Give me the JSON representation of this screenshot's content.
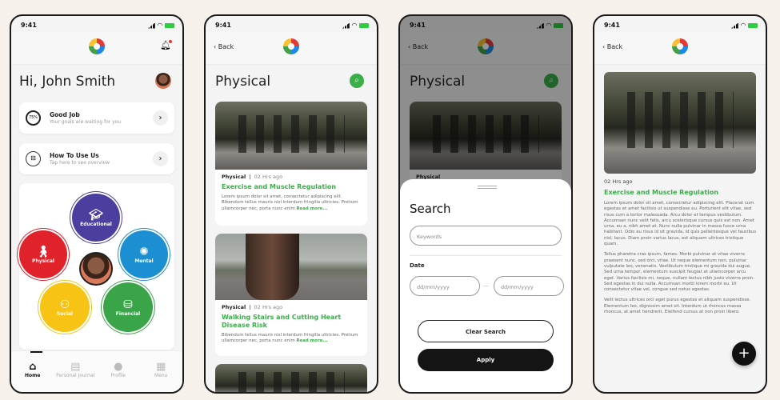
{
  "status": {
    "time": "9:41"
  },
  "home": {
    "greeting": "Hi, John Smith",
    "cards": [
      {
        "badge": "75%",
        "title": "Good Job",
        "subtitle": "Your goals are waiting for you"
      },
      {
        "title": "How To Use Us",
        "subtitle": "Tap here to see overview"
      }
    ],
    "categories": [
      {
        "label": "Educational",
        "color": "#4a3f9f",
        "icon": "graduate-icon"
      },
      {
        "label": "Physical",
        "color": "#e0222a",
        "icon": "walking-icon"
      },
      {
        "label": "Mental",
        "color": "#1b8fd2",
        "icon": "brain-icon"
      },
      {
        "label": "Social",
        "color": "#f7c416",
        "icon": "people-icon"
      },
      {
        "label": "Financial",
        "color": "#3aa449",
        "icon": "coins-icon"
      }
    ],
    "nav": [
      {
        "label": "Home",
        "icon": "home-icon"
      },
      {
        "label": "Personal Journal",
        "icon": "journal-icon"
      },
      {
        "label": "Profile",
        "icon": "profile-icon"
      },
      {
        "label": "Menu",
        "icon": "grid-icon"
      }
    ]
  },
  "back_label": "Back",
  "list": {
    "title": "Physical",
    "articles": [
      {
        "category": "Physical",
        "time": "02 Hrs ago",
        "title": "Exercise and Muscle Regulation",
        "excerpt": "Lorem ipsum dolor sit amet, consectetur adipiscing elit. Bibendum tellus mauris nisl interdum fringilla ultricies. Pretium ullamcorper nec, porta nunc enim",
        "more": "Read more..."
      },
      {
        "category": "Physical",
        "time": "02 Hrs ago",
        "title": "Walking Stairs and Cutting Heart Disease Risk",
        "excerpt": "Bibendum tellus mauris nisl interdum fringilla ultricies. Pretium ullamcorper nec, porta nunc enim",
        "more": "Read more..."
      }
    ]
  },
  "search": {
    "title": "Search",
    "keywords_placeholder": "Keywords",
    "date_label": "Date",
    "date_from_placeholder": "dd/mm/yyyy",
    "date_separator": "—",
    "date_to_placeholder": "dd/mm/yyyy",
    "clear_label": "Clear Search",
    "apply_label": "Apply",
    "behind_category": "Physical"
  },
  "detail": {
    "time": "02 Hrs ago",
    "title": "Exercise and Muscle Regulation",
    "paragraphs": [
      "Lorem ipsum dolor sit amet, consectetur adipiscing elit. Placerat cum egestas et amet facilisis ut suspendisse eu. Porturient elit vitae, sed risus cum a tortor malesuada. Arcu dolor et tempus vestibulum. Accumsan nunc velit felis, arcu scelerisque cursus quis est non. Amet urna, eu a, nibh amet at. Nunc nulla pulvinar in massa fusce urna habitant. Odio eu risus id sit gravida, id quis pellentesque vel faucibus nisl, lacus. Diam proin varius lacus, est aliquam ultrices tristique quam.",
      "Tellus pharetra cras ipsum, fames. Morbi pulvinar at vitae viverra praesent nunc, sed orci, vitae. Ut neque elementum non, pulvinar vulputate leo, venenatis. Vestibulum tristique mi gravida dui augue. Sed urna tempor, elementum suscipit feugiat at ullamcorper arcu eget. Varius facilisis mi, neque, nullam lectus nibh justo viverra proin. Sed egestas in dui nulla. Accumsan morbi lorem morbi eu. Ut consectetur vitae vel, congue sed netus egestas.",
      "Velit lectus ultrices orci eget purus egestas et aliquam suspendisse. Elementum leo, dignissim amet sit. Interdum ut rhoncus massa rhoncus, at amet hendrerit. Eleifend cursus at non proin libero"
    ]
  }
}
